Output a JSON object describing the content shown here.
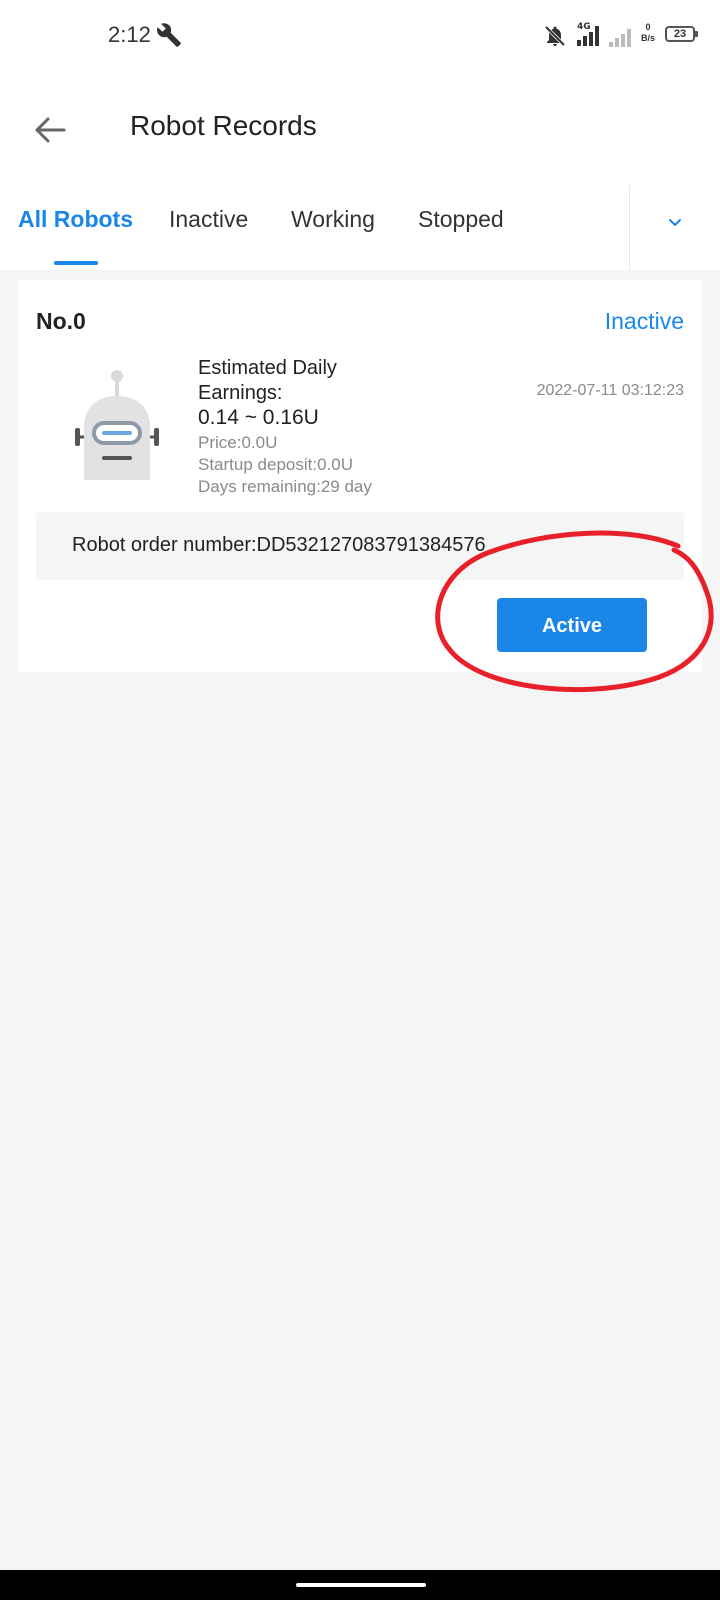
{
  "status_bar": {
    "time": "2:12",
    "network_type": "4G",
    "net_speed_value": "0",
    "net_speed_unit": "B/s",
    "battery": "23"
  },
  "header": {
    "title": "Robot Records"
  },
  "tabs": [
    {
      "label": "All Robots"
    },
    {
      "label": "Inactive"
    },
    {
      "label": "Working"
    },
    {
      "label": "Stopped"
    }
  ],
  "robot_card": {
    "number": "No.0",
    "status": "Inactive",
    "earnings_label": "Estimated Daily Earnings:",
    "earnings_value": "0.14 ~ 0.16U",
    "date": "2022-07-11 03:12:23",
    "price": "Price:0.0U",
    "startup_deposit": "Startup deposit:0.0U",
    "days_remaining": "Days remaining:29 day",
    "order_number": "Robot order number:DD532127083791384576",
    "action_button": "Active"
  },
  "colors": {
    "accent": "#1a87e8",
    "annotation": "#e8202a"
  }
}
